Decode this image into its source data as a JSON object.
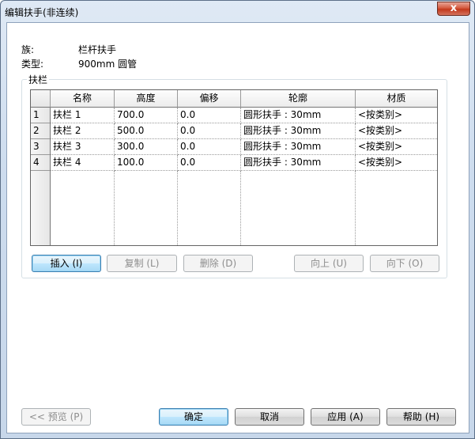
{
  "window": {
    "title": "编辑扶手(非连续)",
    "close_label": "x"
  },
  "info": {
    "family_label": "族:",
    "family_value": "栏杆扶手",
    "type_label": "类型:",
    "type_value": "900mm 圆管"
  },
  "group": {
    "title": "扶栏"
  },
  "table": {
    "columns": [
      "名称",
      "高度",
      "偏移",
      "轮廓",
      "材质"
    ],
    "rows": [
      {
        "num": "1",
        "name": "扶栏 1",
        "height": "700.0",
        "offset": "0.0",
        "profile": "圆形扶手 : 30mm",
        "material": "<按类别>"
      },
      {
        "num": "2",
        "name": "扶栏 2",
        "height": "500.0",
        "offset": "0.0",
        "profile": "圆形扶手 : 30mm",
        "material": "<按类别>"
      },
      {
        "num": "3",
        "name": "扶栏 3",
        "height": "300.0",
        "offset": "0.0",
        "profile": "圆形扶手 : 30mm",
        "material": "<按类别>"
      },
      {
        "num": "4",
        "name": "扶栏 4",
        "height": "100.0",
        "offset": "0.0",
        "profile": "圆形扶手 : 30mm",
        "material": "<按类别>"
      }
    ]
  },
  "buttons": {
    "insert": "插入 (I)",
    "copy": "复制 (L)",
    "delete": "删除 (D)",
    "up": "向上 (U)",
    "down": "向下 (O)",
    "preview": "<< 预览 (P)",
    "ok": "确定",
    "cancel": "取消",
    "apply": "应用 (A)",
    "help": "帮助 (H)"
  }
}
